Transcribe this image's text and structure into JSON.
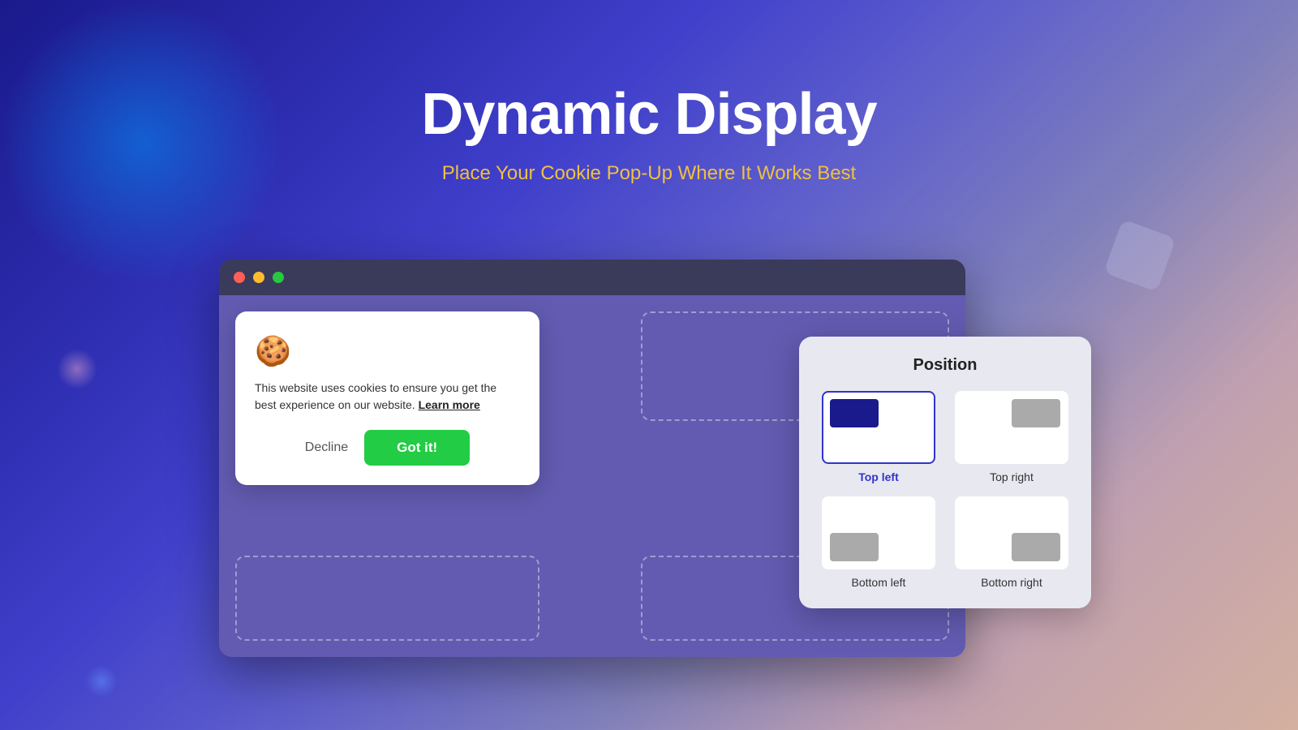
{
  "header": {
    "title": "Dynamic Display",
    "subtitle": "Place Your Cookie Pop-Up Where It Works Best"
  },
  "browser": {
    "dots": [
      "red",
      "yellow",
      "green"
    ]
  },
  "cookie_popup": {
    "icon": "🍪",
    "text": "This website uses cookies to ensure you get the best experience on our website.",
    "learn_more": "Learn more",
    "decline_label": "Decline",
    "gotit_label": "Got it!"
  },
  "position_panel": {
    "title": "Position",
    "options": [
      {
        "id": "top-left",
        "label": "Top left",
        "selected": true
      },
      {
        "id": "top-right",
        "label": "Top right",
        "selected": false
      },
      {
        "id": "bottom-left",
        "label": "Bottom left",
        "selected": false
      },
      {
        "id": "bottom-right",
        "label": "Bottom right",
        "selected": false
      }
    ]
  }
}
